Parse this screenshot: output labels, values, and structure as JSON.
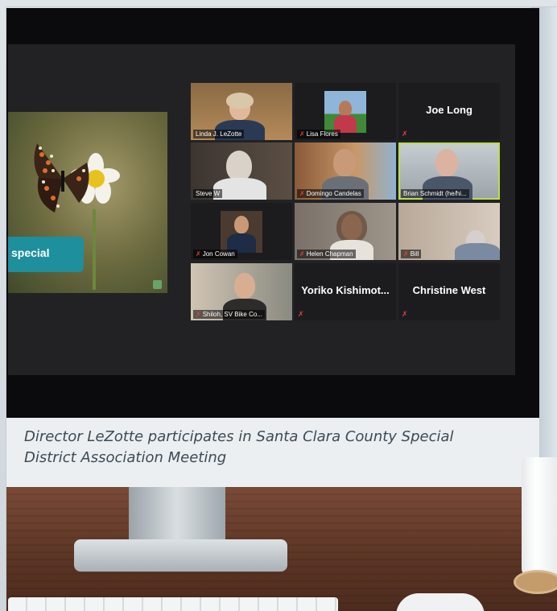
{
  "caption": "Director LeZotte participates in Santa Clara County Special District Association Meeting",
  "shared_screen": {
    "banner_text": "special"
  },
  "participants": [
    {
      "name": "Linda J. LeZotte",
      "muted": false,
      "video": true,
      "active": false
    },
    {
      "name": "Lisa Flores",
      "muted": true,
      "video": true,
      "active": false
    },
    {
      "name": "Joe Long",
      "muted": true,
      "video": false,
      "active": false
    },
    {
      "name": "Steve W",
      "muted": false,
      "video": true,
      "active": false
    },
    {
      "name": "Domingo Candelas",
      "muted": true,
      "video": true,
      "active": false
    },
    {
      "name": "Brian Schmidt (he/hi...",
      "muted": false,
      "video": true,
      "active": true
    },
    {
      "name": "Jon Cowan",
      "muted": true,
      "video": true,
      "active": false
    },
    {
      "name": "Helen Chapman",
      "muted": true,
      "video": true,
      "active": false
    },
    {
      "name": "Bill",
      "muted": true,
      "video": true,
      "active": false
    },
    {
      "name": "Shiloh, SV Bike Co...",
      "muted": true,
      "video": true,
      "active": false
    },
    {
      "name": "Yoriko  Kishimot...",
      "muted": true,
      "video": false,
      "active": false
    },
    {
      "name": "Christine West",
      "muted": true,
      "video": false,
      "active": false
    }
  ],
  "mute_icon": "microphone-muted-icon",
  "colors": {
    "active_speaker": "#b8e04a",
    "banner": "#1e8f9c",
    "muted": "#e0413a"
  }
}
